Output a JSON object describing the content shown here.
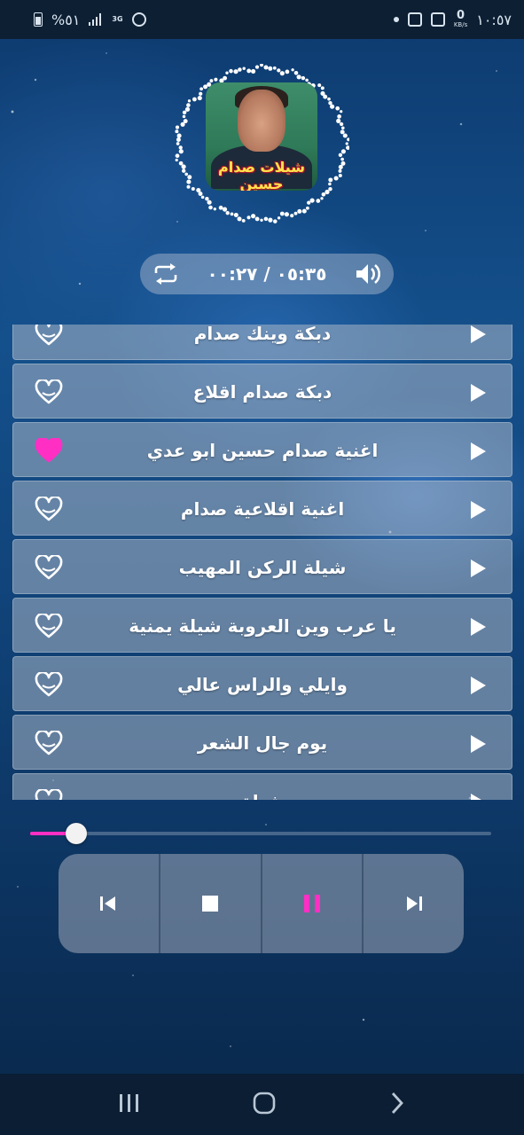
{
  "status_bar": {
    "battery": "%٥١",
    "network": "3G",
    "speed_value": "0",
    "speed_unit": "KB/s",
    "time": "١٠:٥٧"
  },
  "album": {
    "caption": "شيلات صدام حسين"
  },
  "player": {
    "time_display": "٠٥:٣٥ / ٠٠:٢٧",
    "progress": 0.08
  },
  "playlist": {
    "songs": [
      {
        "title": "دبكة وينك صدام",
        "favorite": false
      },
      {
        "title": "دبكة صدام اقلاع",
        "favorite": false
      },
      {
        "title": "اغنية صدام حسين ابو عدي",
        "favorite": true
      },
      {
        "title": "اغنية اقلاعية صدام",
        "favorite": false
      },
      {
        "title": "شيلة الركن المهيب",
        "favorite": false
      },
      {
        "title": "يا عرب وين العروبة شيلة يمنية",
        "favorite": false
      },
      {
        "title": "وايلي والراس عالي",
        "favorite": false
      },
      {
        "title": "يوم جال الشعر",
        "favorite": false
      },
      {
        "title": "شيلة",
        "favorite": false
      }
    ]
  },
  "colors": {
    "accent": "#ff2fc4",
    "heart_filled": "#ff2fc4",
    "heart_outline": "#ffffff"
  },
  "icons": {
    "repeat": "repeat-icon",
    "volume": "volume-icon",
    "heart": "heart-icon",
    "play": "play-icon",
    "previous": "previous-icon",
    "stop": "stop-icon",
    "pause": "pause-icon",
    "next": "next-icon"
  }
}
